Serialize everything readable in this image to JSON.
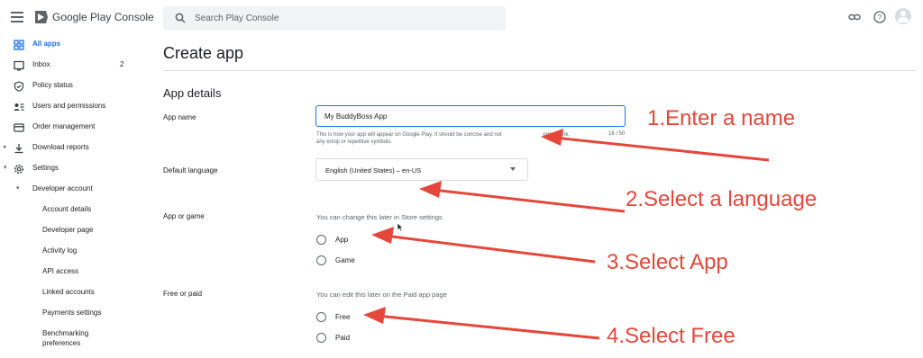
{
  "header": {
    "brand": "Google Play Console",
    "search_placeholder": "Search Play Console",
    "icons": [
      "menu-icon",
      "play-console-logo",
      "search-icon",
      "link-icon",
      "help-icon",
      "account-avatar-icon"
    ]
  },
  "sidebar": {
    "items": [
      {
        "label": "All apps",
        "icon": "grid-icon",
        "active": true
      },
      {
        "label": "Inbox",
        "icon": "inbox-icon",
        "badge": "2"
      },
      {
        "label": "Policy status",
        "icon": "shield-icon"
      },
      {
        "label": "Users and permissions",
        "icon": "users-icon"
      },
      {
        "label": "Order management",
        "icon": "card-icon"
      },
      {
        "label": "Download reports",
        "icon": "download-icon"
      },
      {
        "label": "Settings",
        "icon": "gear-icon"
      },
      {
        "label": "Developer account"
      },
      {
        "label": "Account details"
      },
      {
        "label": "Developer page"
      },
      {
        "label": "Activity log"
      },
      {
        "label": "API access"
      },
      {
        "label": "Linked accounts"
      },
      {
        "label": "Payments settings"
      },
      {
        "label": "Benchmarking"
      },
      {
        "label": "preferences"
      }
    ]
  },
  "main": {
    "title": "Create app",
    "section": "App details",
    "app_name": {
      "label": "App name",
      "value": "My BuddyBoss App",
      "helper_line1": "This is how your app will appear on Google Play. It should be concise and not",
      "helper_line1b": "price, rank,",
      "helper_line2": "any emoji or repetitive symbols.",
      "counter": "16 / 50"
    },
    "default_language": {
      "label": "Default language",
      "value": "English (United States) – en-US"
    },
    "app_or_game": {
      "label": "App or game",
      "hint": "You can change this later in Store settings",
      "options": [
        "App",
        "Game"
      ]
    },
    "free_or_paid": {
      "label": "Free or paid",
      "hint": "You can edit this later on the Paid app page",
      "options": [
        "Free",
        "Paid"
      ]
    }
  },
  "annotations": [
    "1.Enter a name",
    "2.Select a language",
    "3.Select App",
    "4.Select Free"
  ],
  "colors": {
    "accent": "#1a73e8",
    "annotation": "#e5473b"
  }
}
